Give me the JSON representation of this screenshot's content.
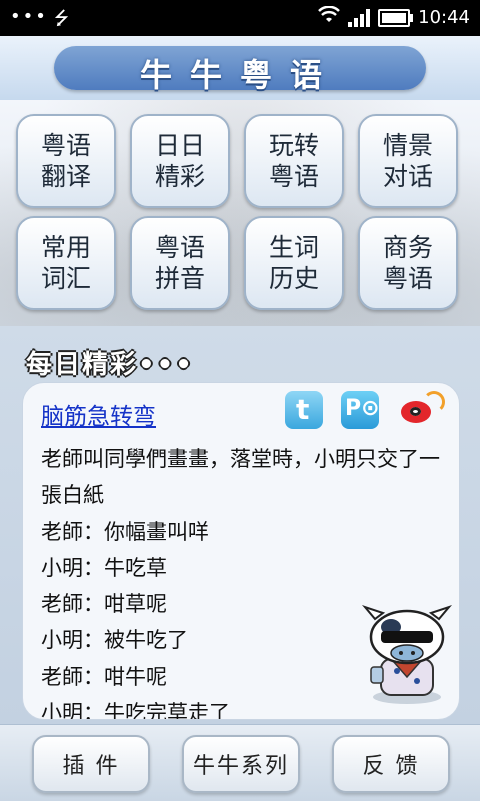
{
  "status_bar": {
    "dots": "•••",
    "usb_icon": "usb-icon",
    "time": "10:44"
  },
  "header": {
    "title": "牛牛粤语"
  },
  "menu": [
    {
      "label": "粤语\n翻译"
    },
    {
      "label": "日日\n精彩"
    },
    {
      "label": "玩转\n粤语"
    },
    {
      "label": "情景\n对话"
    },
    {
      "label": "常用\n词汇"
    },
    {
      "label": "粤语\n拼音"
    },
    {
      "label": "生词\n历史"
    },
    {
      "label": "商务\n粤语"
    }
  ],
  "daily": {
    "heading": "每日精彩•••",
    "article_title": "脑筋急转弯",
    "share_icons": [
      "twitter-icon",
      "pp-icon",
      "weibo-icon"
    ],
    "lines": [
      "老師叫同學們畫畫，落堂時，小明只交了一張白紙",
      "老師：你幅畫叫咩",
      "小明：牛吃草",
      "老師：咁草呢",
      "小明：被牛吃了",
      "老師：咁牛呢",
      "小明：牛吃完草走了"
    ]
  },
  "bottom": {
    "plugin": "插 件",
    "series": "牛牛系列",
    "feedback": "反 馈"
  }
}
